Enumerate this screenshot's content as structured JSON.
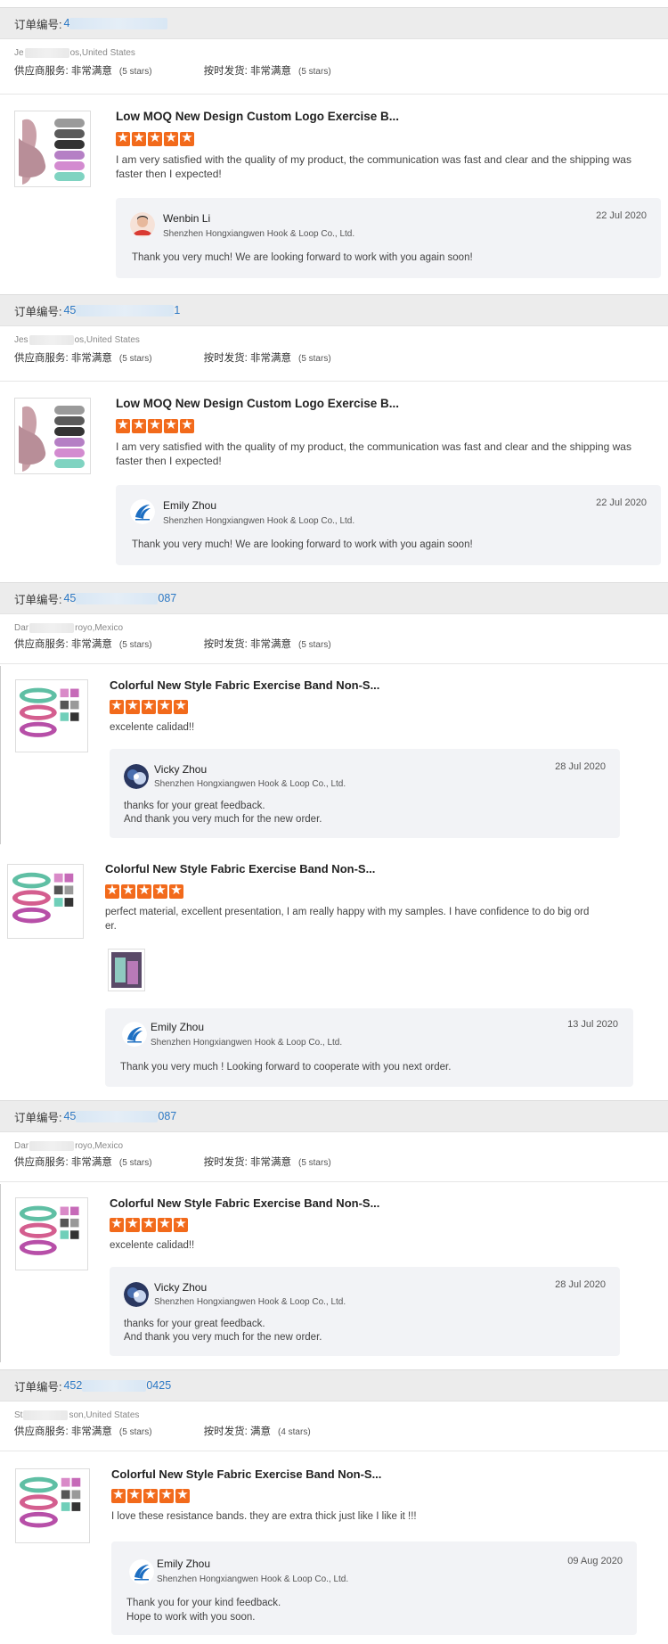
{
  "labels": {
    "order_no": "订单编号:",
    "supplier_service": "供应商服务:",
    "on_time": "按时发货:"
  },
  "orders": [
    {
      "order_prefix": "4",
      "order_suffix": "",
      "buyer_prefix": "Je",
      "buyer_suffix": "os,United States",
      "service_rating": "非常满意",
      "service_stars": "(5 stars)",
      "ontime_rating": "非常满意",
      "ontime_stars": "(5 stars)"
    },
    {
      "order_prefix": "45",
      "order_suffix": "1",
      "buyer_prefix": "Jes",
      "buyer_suffix": "os,United States",
      "service_rating": "非常满意",
      "service_stars": "(5 stars)",
      "ontime_rating": "非常满意",
      "ontime_stars": "(5 stars)"
    },
    {
      "order_prefix": "45",
      "order_suffix": "087",
      "buyer_prefix": "Dar",
      "buyer_suffix": "royo,Mexico",
      "service_rating": "非常满意",
      "service_stars": "(5 stars)",
      "ontime_rating": "非常满意",
      "ontime_stars": "(5 stars)"
    },
    {
      "order_prefix": "45",
      "order_suffix": "087",
      "buyer_prefix": "Dar",
      "buyer_suffix": "royo,Mexico",
      "service_rating": "非常满意",
      "service_stars": "(5 stars)",
      "ontime_rating": "非常满意",
      "ontime_stars": "(5 stars)"
    },
    {
      "order_prefix": "452",
      "order_suffix": "0425",
      "buyer_prefix": "St",
      "buyer_suffix": "son,United States",
      "service_rating": "非常满意",
      "service_stars": "(5 stars)",
      "ontime_rating": "满意",
      "ontime_stars": "(4 stars)"
    }
  ],
  "reviews": [
    {
      "title": "Low MOQ New Design Custom Logo Exercise B...",
      "stars": 5,
      "text": "I am very satisfied with the quality of my product, the communication was fast and clear and the shipping was faster then I expected!",
      "reply": {
        "name": "Wenbin Li",
        "company": "Shenzhen Hongxiangwen Hook & Loop Co., Ltd.",
        "date": "22 Jul 2020",
        "text": "Thank you very much!  We are looking forward to work with you again soon!"
      }
    },
    {
      "title": "Low MOQ New Design Custom Logo Exercise B...",
      "stars": 5,
      "text": "I am very satisfied with the quality of my product, the communication was fast and clear and the shipping was faster then I expected!",
      "reply": {
        "name": "Emily Zhou",
        "company": "Shenzhen Hongxiangwen Hook & Loop Co., Ltd.",
        "date": "22 Jul 2020",
        "text": "Thank you very much!  We are looking forward to work with you again soon!"
      }
    },
    {
      "title": "Colorful New Style Fabric Exercise Band Non-S...",
      "stars": 5,
      "text": "excelente calidad!!",
      "reply": {
        "name": "Vicky Zhou",
        "company": "Shenzhen Hongxiangwen Hook & Loop Co., Ltd.",
        "date": "28 Jul 2020",
        "text1": "thanks for your great feedback.",
        "text2": "And thank you very much for the new order."
      }
    },
    {
      "title": "Colorful New Style Fabric Exercise Band Non-S...",
      "stars": 5,
      "text1": "perfect material, excellent presentation, I am really happy with my samples. I have confidence to do big ord",
      "text2": "er.",
      "reply": {
        "name": "Emily Zhou",
        "company": "Shenzhen Hongxiangwen Hook & Loop Co., Ltd.",
        "date": "13 Jul 2020",
        "text": "Thank you very much ! Looking forward to cooperate with you next order."
      }
    },
    {
      "title": "Colorful New Style Fabric Exercise Band Non-S...",
      "stars": 5,
      "text": "excelente calidad!!",
      "reply": {
        "name": "Vicky Zhou",
        "company": "Shenzhen Hongxiangwen Hook & Loop Co., Ltd.",
        "date": "28 Jul 2020",
        "text1": "thanks for your great feedback.",
        "text2": "And thank you very much for the new order."
      }
    },
    {
      "title": "Colorful New Style Fabric Exercise Band Non-S...",
      "stars": 5,
      "text": "I love these resistance bands. they are extra thick just like I like it !!!",
      "reply": {
        "name": "Emily Zhou",
        "company": "Shenzhen Hongxiangwen Hook & Loop Co., Ltd.",
        "date": "09 Aug 2020",
        "text1": "Thank you for your kind feedback.",
        "text2": "Hope to work with you soon."
      }
    }
  ],
  "colors": {
    "star": "#f26a1b",
    "link": "#2b78c5",
    "header_bg": "#ececec",
    "reply_bg": "#f2f3f6"
  }
}
